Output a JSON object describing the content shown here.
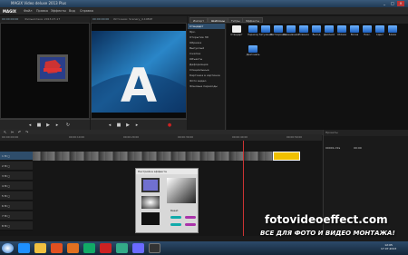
{
  "window": {
    "title": "MAGIX Video deluxe 2013 Plus"
  },
  "menu": {
    "logo": "MAGIX",
    "items": [
      "Файл",
      "Правка",
      "Эффекты",
      "Вид",
      "Справка"
    ]
  },
  "source_monitor": {
    "header": "Фильмотека: 2013-07-17",
    "timecode": "00:00:00:00"
  },
  "program_monitor": {
    "header": "Источник: Scenery_4.1080P",
    "timecode_left": "00:00:00:00",
    "timecode_right": "00:01:25:00"
  },
  "tabs": [
    "Импорт",
    "Шаблоны",
    "Титры",
    "Эффекты"
  ],
  "side_menu": [
    "Стандарт",
    "Ярк.",
    "Открытие 3D",
    "Обрезка",
    "Выпуклый",
    "Сжатие",
    "Объекты",
    "Деформация",
    "Специальные",
    "Картинка в картинке",
    "Фото видео",
    "Фоновые переходы"
  ],
  "effects": [
    "Стандарт",
    "Переход",
    "Затухание",
    "Растворение",
    "Смешивание",
    "Плавное",
    "Выход",
    "Двойной",
    "Облака",
    "Волна",
    "Пикс.",
    "Сдвиг",
    "Блики",
    "Диагональ"
  ],
  "ruler": {
    "label": "00:00:00:00",
    "ticks": [
      "00:00:10:00",
      "00:00:20:00",
      "00:00:30:00",
      "00:00:40:00",
      "00:00:50:00"
    ]
  },
  "tracks": [
    "1",
    "2",
    "3",
    "4",
    "5",
    "6",
    "7",
    "8"
  ],
  "dialog": {
    "title": "Настройка эффекта",
    "reset": "Reset"
  },
  "right_panel": {
    "header": "Проекты",
    "item": "00001.mts",
    "item_dur": "00:00"
  },
  "watermark": {
    "site": "fotovideoeffect.com",
    "tagline": "ВСЕ ДЛЯ ФОТО И ВИДЕО МОНТАЖА!"
  },
  "clock": {
    "time": "12:05",
    "date": "17.07.2013"
  },
  "colors": {
    "accent": "#2e4d6b",
    "playhead": "#cc3333",
    "brand_blue": "#1d5fbf"
  }
}
